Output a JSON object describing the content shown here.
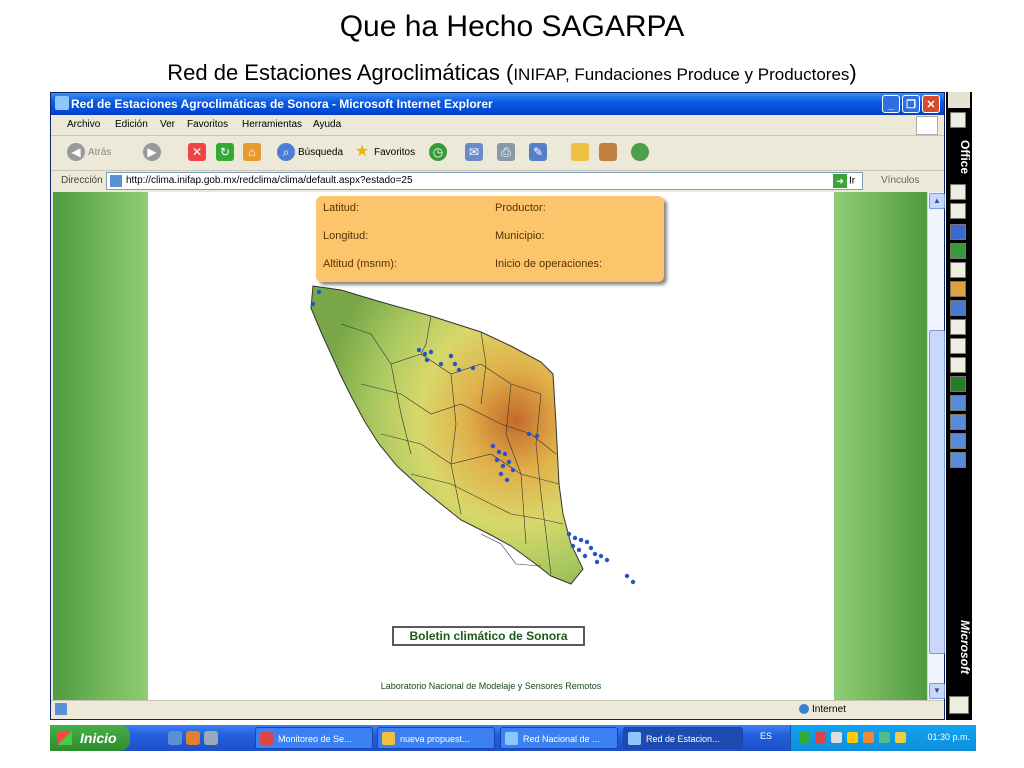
{
  "slide": {
    "title": "Que ha Hecho SAGARPA",
    "subtitle_main": "Red de Estaciones Agroclimáticas (",
    "subtitle_small": "INIFAP, Fundaciones Produce y Productores",
    "subtitle_close": ")"
  },
  "window": {
    "title": "Red de Estaciones Agroclimáticas de Sonora - Microsoft Internet Explorer",
    "controls": [
      "minimize",
      "maximize",
      "close"
    ]
  },
  "menu": [
    "Archivo",
    "Edición",
    "Ver",
    "Favoritos",
    "Herramientas",
    "Ayuda"
  ],
  "toolbar": {
    "back": "Atrás",
    "search": "Búsqueda",
    "favorites": "Favoritos"
  },
  "address": {
    "label": "Dirección",
    "url": "http://clima.inifap.gob.mx/redclima/clima/default.aspx?estado=25",
    "go": "Ir",
    "links": "Vínculos"
  },
  "page": {
    "info": {
      "latitud": "Latitud:",
      "longitud": "Longitud:",
      "altitud": "Altitud (msnm):",
      "productor": "Productor:",
      "municipio": "Municipio:",
      "inicio": "Inicio de operaciones:"
    },
    "boletin": "Boletin climático de Sonora",
    "footer": "Laboratorio Nacional de Modelaje y Sensores Remotos"
  },
  "status": {
    "zone": "Internet"
  },
  "officebar": {
    "top": "Office",
    "bottom": "Microsoft"
  },
  "taskbar": {
    "start": "Inicio",
    "tasks": [
      "Monitoreo de Se...",
      "nueva propuest...",
      "Red Nacional de ...",
      "Red de Estacion..."
    ],
    "lang": "ES",
    "clock": "01:30 p.m."
  },
  "colors": {
    "xp_blue": "#0a5ce6",
    "info_box": "#fcc56c",
    "green_frame": "#78ba60",
    "station_dot": "#2255cc"
  }
}
